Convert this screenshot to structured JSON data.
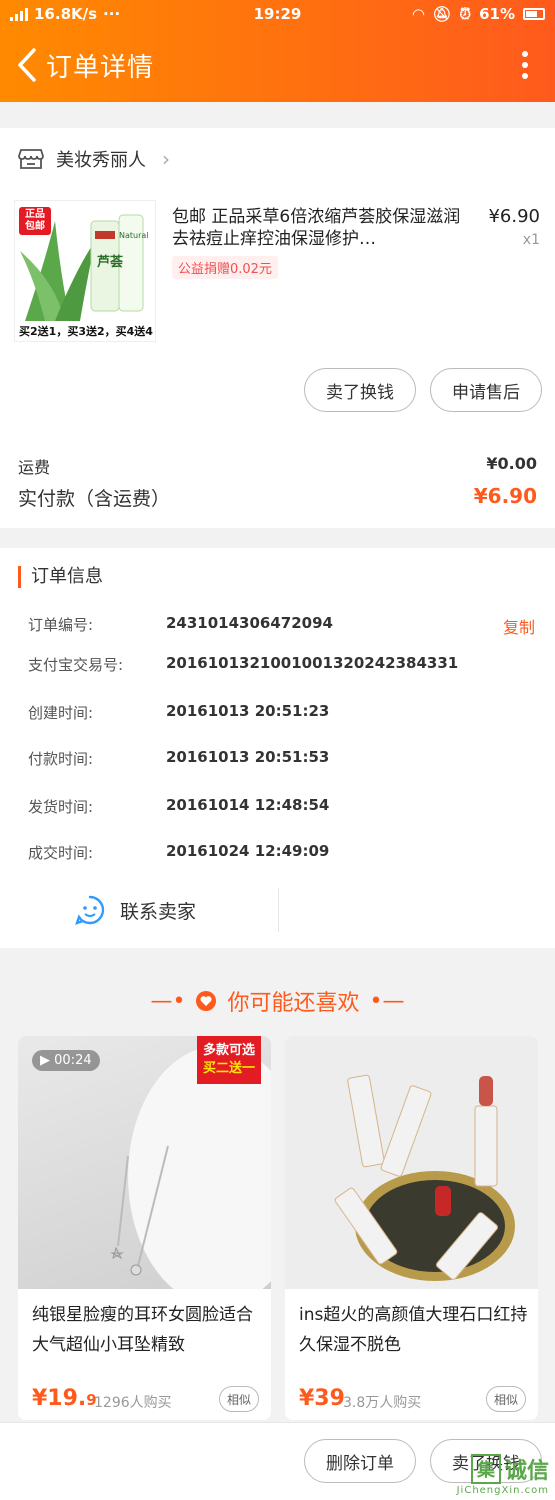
{
  "status_bar": {
    "network": "2G 4G 4G",
    "speed": "16.8K/s",
    "dots": "···",
    "time": "19:29",
    "battery": "61%"
  },
  "nav": {
    "title": "订单详情"
  },
  "shop": {
    "name": "美妆秀丽人"
  },
  "product": {
    "title": "包邮 正品采草6倍浓缩芦荟胶保湿滋润去祛痘止痒控油保湿修护…",
    "price": "¥6.90",
    "qty": "x1",
    "charity": "公益捐赠0.02元",
    "image_badge": "正品包邮",
    "image_caption": "买2送1，买3送2，买4送4",
    "image_brand": "芦荟",
    "image_brand_en": "Natural"
  },
  "order_actions": {
    "sell_label": "卖了换钱",
    "after_sale_label": "申请售后"
  },
  "summary": {
    "shipping_label": "运费",
    "shipping_value": "¥0.00",
    "paid_label": "实付款（含运费）",
    "paid_value": "¥6.90"
  },
  "info": {
    "title": "订单信息",
    "copy_label": "复制",
    "rows": [
      {
        "key": "订单编号:",
        "value": "2431014306472094"
      },
      {
        "key": "支付宝交易号:",
        "value": "2016101321001001320242384331"
      },
      {
        "key": "创建时间:",
        "value": "20161013 20:51:23"
      },
      {
        "key": "付款时间:",
        "value": "20161013 20:51:53"
      },
      {
        "key": "发货时间:",
        "value": "20161014 12:48:54"
      },
      {
        "key": "成交时间:",
        "value": "20161024 12:49:09"
      }
    ],
    "contact_label": "联系卖家"
  },
  "recommend": {
    "title": "你可能还喜欢",
    "items": [
      {
        "name": "纯银星脸瘦的耳环女圆脸适合大气超仙小耳坠精致",
        "price_main": "¥19.",
        "price_decimal": "9",
        "sold": "1296人购买",
        "similar": "相似",
        "video_time": "00:24",
        "promo_line1": "多款可选",
        "promo_line2": "买二送一"
      },
      {
        "name": "ins超火的高颜值大理石口红持久保湿不脱色",
        "price_main": "¥39",
        "sold": "3.8万人购买",
        "similar": "相似"
      }
    ]
  },
  "bottom_actions": {
    "delete_label": "删除订单",
    "sell_label": "卖了换钱"
  },
  "watermark": {
    "top": "诚信",
    "box": "集",
    "sub": "JiChengXin.com"
  },
  "colors": {
    "accent": "#ff5a1d",
    "header_start": "#ff8a00"
  }
}
